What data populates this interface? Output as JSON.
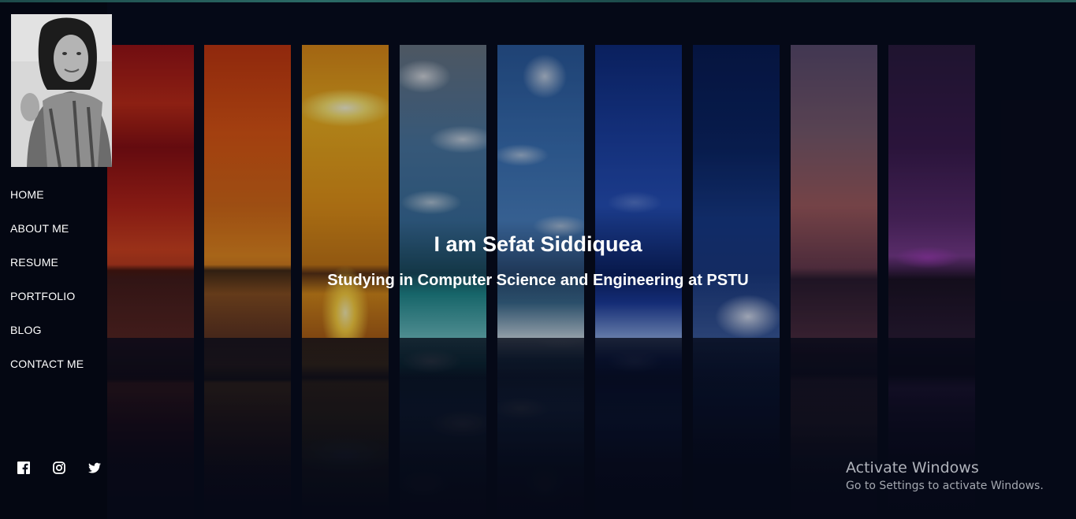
{
  "profile": {
    "photo_alt": "Profile photo"
  },
  "nav": {
    "items": [
      {
        "label": "HOME"
      },
      {
        "label": "ABOUT ME"
      },
      {
        "label": "RESUME"
      },
      {
        "label": "PORTFOLIO"
      },
      {
        "label": "BLOG"
      },
      {
        "label": "CONTACT ME"
      }
    ]
  },
  "social": {
    "icons": [
      "facebook-icon",
      "instagram-icon",
      "twitter-icon"
    ]
  },
  "hero": {
    "title": "I am Sefat Siddiquea",
    "subtitle": "Studying in Computer Science and Engineering at PSTU"
  },
  "watermark": {
    "title": "Activate Windows",
    "subtitle": "Go to Settings to activate Windows."
  },
  "colors": {
    "background": "#070b19",
    "text": "#ffffff",
    "top_accent": "#2b6a66"
  }
}
